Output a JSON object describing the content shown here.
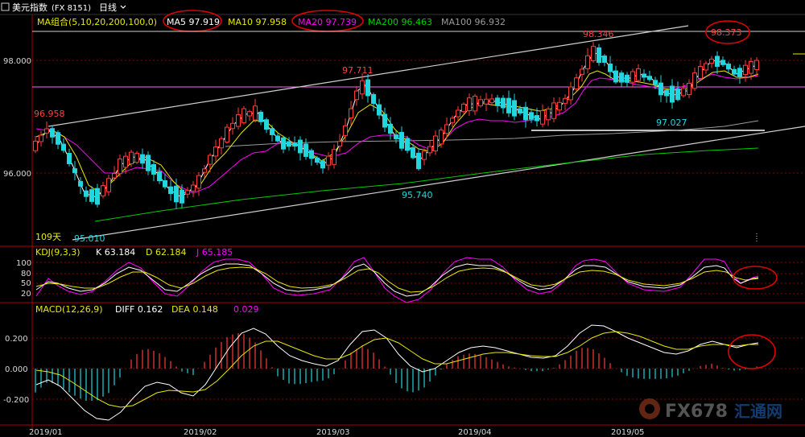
{
  "window": {
    "title_prefix": "美元指数",
    "instrument_code": "(FX 8151)",
    "period": "日线",
    "period_icon": "chevron-down-icon"
  },
  "colors": {
    "up": "#ff3b3b",
    "down": "#21d6dc",
    "ma5": "#ffffff",
    "ma10": "#e8e800",
    "ma20": "#ff00ff",
    "ma200": "#00cc00",
    "ma100": "#9a9a9a",
    "annotation_circle": "#e00000",
    "grid": "#8a0000",
    "axis_text": "#d8d8d8"
  },
  "panels": {
    "price": {
      "legend": {
        "group": "MA组合(5,10,20,200,100,0)",
        "ma5": "MA5 97.919",
        "ma10": "MA10 97.958",
        "ma20": "MA20 97.739",
        "ma200": "MA200 96.463",
        "ma100": "MA100 96.932"
      },
      "yticks": [
        "98.000",
        "96.000"
      ],
      "price_labels": {
        "p1": "96.958",
        "p2": "97.711",
        "p3": "98.346",
        "p4": "98.373",
        "p5": "95.740",
        "p6": "97.027",
        "p7": "95.010",
        "days": "109天"
      }
    },
    "kdj": {
      "legend": {
        "name": "KDJ(9,3,3)",
        "k": "K 63.184",
        "d": "D 62.184",
        "j": "J 65.185"
      },
      "yticks": [
        "100",
        "80",
        "50",
        "20"
      ]
    },
    "macd": {
      "legend": {
        "name": "MACD(12,26,9)",
        "diff": "DIFF 0.162",
        "dea": "DEA 0.148",
        "macd": "0.029"
      },
      "yticks": [
        "0.200",
        "0.000",
        "-0.200"
      ]
    }
  },
  "xaxis": {
    "labels": [
      "2019/01",
      "2019/02",
      "2019/03",
      "2019/04",
      "2019/05"
    ]
  },
  "watermark": {
    "brand": "FX678",
    "cn": "汇通网"
  },
  "chart_data": [
    {
      "type": "candlestick",
      "title": "美元指数 (FX 8151) 日线",
      "ylim": [
        94.8,
        98.95
      ],
      "x": [
        "2019/01",
        "2019/02",
        "2019/03",
        "2019/04",
        "2019/05"
      ],
      "key_prices": {
        "high_1": 96.958,
        "high_2": 97.711,
        "high_3": 98.346,
        "high_4": 98.373,
        "low_1": 95.01,
        "low_2": 95.74,
        "low_3": 97.027
      },
      "series": [
        {
          "name": "MA5",
          "last": 97.919
        },
        {
          "name": "MA10",
          "last": 97.958
        },
        {
          "name": "MA20",
          "last": 97.739
        },
        {
          "name": "MA200",
          "last": 96.463
        },
        {
          "name": "MA100",
          "last": 96.932
        }
      ],
      "grid": true
    },
    {
      "type": "line",
      "title": "KDJ(9,3,3)",
      "ylim": [
        0,
        100
      ],
      "series": [
        {
          "name": "K",
          "last": 63.184
        },
        {
          "name": "D",
          "last": 62.184
        },
        {
          "name": "J",
          "last": 65.185
        }
      ]
    },
    {
      "type": "bar",
      "title": "MACD(12,26,9)",
      "ylim": [
        -0.35,
        0.35
      ],
      "series": [
        {
          "name": "DIFF",
          "last": 0.162
        },
        {
          "name": "DEA",
          "last": 0.148
        },
        {
          "name": "MACD",
          "last": 0.029
        }
      ]
    }
  ]
}
